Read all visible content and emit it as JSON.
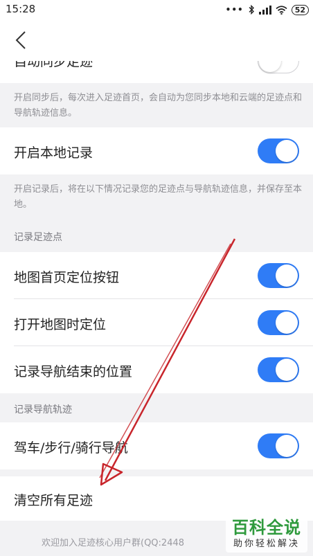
{
  "status_bar": {
    "time": "15:28",
    "battery": "52"
  },
  "rows": {
    "auto_sync": {
      "label": "自动同步足迹",
      "on": false
    },
    "local_record": {
      "label": "开启本地记录",
      "on": true
    },
    "map_locate_button": {
      "label": "地图首页定位按钮",
      "on": true
    },
    "open_map_locate": {
      "label": "打开地图时定位",
      "on": true
    },
    "nav_end_position": {
      "label": "记录导航结束的位置",
      "on": true
    },
    "drive_walk_ride_nav": {
      "label": "驾车/步行/骑行导航",
      "on": true
    },
    "clear_all": {
      "label": "清空所有足迹"
    }
  },
  "notes": {
    "sync_note": "开启同步后，每次进入足迹首页，会自动为您同步本地和云端的足迹点和导航轨迹信息。",
    "record_note": "开启记录后，将在以下情况记录您的足迹点与导航轨迹信息，并保存至本地。"
  },
  "sections": {
    "footprint_points": "记录足迹点",
    "nav_tracks": "记录导航轨迹"
  },
  "footer": {
    "text": "欢迎加入足迹核心用户群(QQ:2448"
  },
  "watermark": {
    "title": "百科全说",
    "subtitle": "助你轻松解决"
  },
  "colors": {
    "toggle_on": "#2f7cf6",
    "annotation_arrow": "#c8252b"
  }
}
